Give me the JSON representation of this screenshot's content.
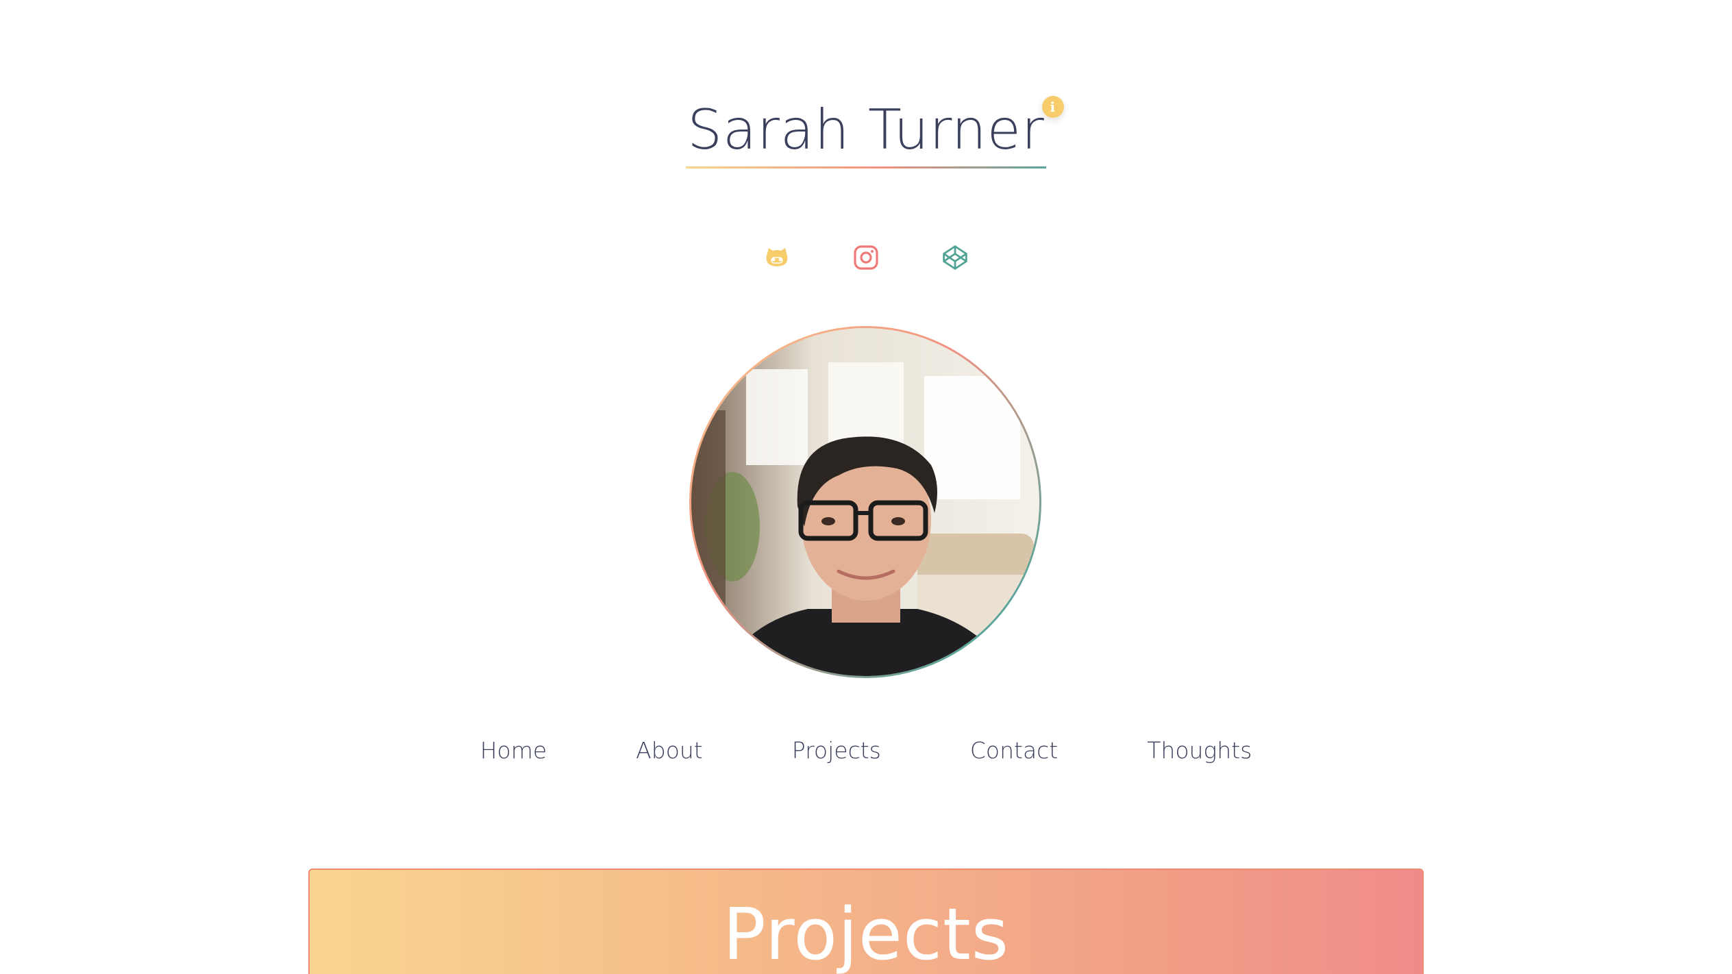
{
  "header": {
    "name": "Sarah Turner",
    "info_badge": "i"
  },
  "socials": [
    {
      "icon": "github-icon",
      "color": "#f6cd6a"
    },
    {
      "icon": "instagram-icon",
      "color": "#ef7878"
    },
    {
      "icon": "codepen-icon",
      "color": "#4fa294"
    }
  ],
  "avatar": {
    "icon": "profile-photo"
  },
  "nav": {
    "items": [
      "Home",
      "About",
      "Projects",
      "Contact",
      "Thoughts"
    ]
  },
  "section": {
    "title": "Projects"
  },
  "colors": {
    "text": "#3a3f5c",
    "accent_yellow": "#f6cd6a",
    "accent_coral": "#ef7878",
    "accent_teal": "#4fa294"
  }
}
